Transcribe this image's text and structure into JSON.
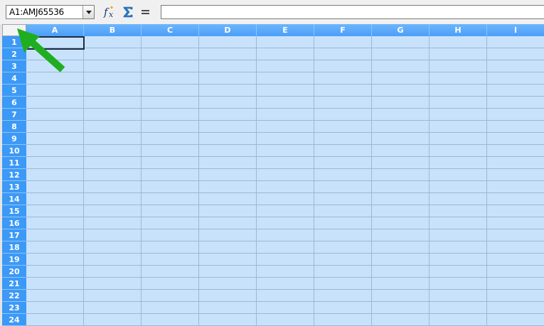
{
  "formula_bar": {
    "name_box_value": "A1:AMJ65536",
    "formula_value": "",
    "icons": [
      "function-wizard-icon",
      "sum-icon",
      "equals-icon"
    ]
  },
  "grid": {
    "columns": [
      "A",
      "B",
      "C",
      "D",
      "E",
      "F",
      "G",
      "H",
      "I"
    ],
    "rows": [
      "1",
      "2",
      "3",
      "4",
      "5",
      "6",
      "7",
      "8",
      "9",
      "10",
      "11",
      "12",
      "13",
      "14",
      "15",
      "16",
      "17",
      "18",
      "19",
      "20",
      "21",
      "22",
      "23",
      "24"
    ]
  },
  "colors": {
    "selection_fill": "#c9e2fc",
    "header_blue": "#55a8fb",
    "annotation_arrow": "#1fae1f"
  }
}
